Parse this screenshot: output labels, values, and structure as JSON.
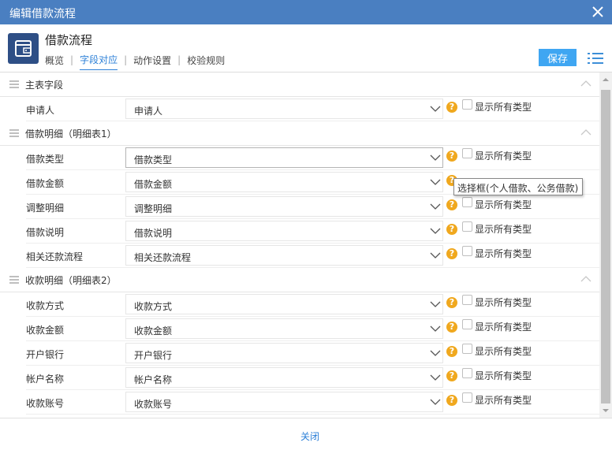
{
  "window": {
    "title": "编辑借款流程"
  },
  "header": {
    "title": "借款流程",
    "tabs": [
      {
        "label": "概览"
      },
      {
        "label": "字段对应",
        "active": true
      },
      {
        "label": "动作设置"
      },
      {
        "label": "校验规则"
      }
    ],
    "save_label": "保存"
  },
  "sections": [
    {
      "title": "主表字段",
      "rows": [
        {
          "label": "申请人",
          "value": "申请人",
          "checkbox_label": "显示所有类型"
        }
      ]
    },
    {
      "title": "借款明细（明细表1）",
      "rows": [
        {
          "label": "借款类型",
          "value": "借款类型",
          "checkbox_label": "显示所有类型"
        },
        {
          "label": "借款金额",
          "value": "借款金额",
          "checkbox_label": "显示所有类型"
        },
        {
          "label": "调整明细",
          "value": "调整明细",
          "checkbox_label": "显示所有类型"
        },
        {
          "label": "借款说明",
          "value": "借款说明",
          "checkbox_label": "显示所有类型"
        },
        {
          "label": "相关还款流程",
          "value": "相关还款流程",
          "checkbox_label": "显示所有类型"
        }
      ]
    },
    {
      "title": "收款明细（明细表2）",
      "rows": [
        {
          "label": "收款方式",
          "value": "收款方式",
          "checkbox_label": "显示所有类型"
        },
        {
          "label": "收款金额",
          "value": "收款金额",
          "checkbox_label": "显示所有类型"
        },
        {
          "label": "开户银行",
          "value": "开户银行",
          "checkbox_label": "显示所有类型"
        },
        {
          "label": "帐户名称",
          "value": "帐户名称",
          "checkbox_label": "显示所有类型"
        },
        {
          "label": "收款账号",
          "value": "收款账号",
          "checkbox_label": "显示所有类型"
        }
      ]
    }
  ],
  "help_glyph": "?",
  "tooltip": {
    "text": "选择框(个人借款、公务借款)"
  },
  "footer": {
    "close_label": "关闭"
  },
  "colors": {
    "titlebar": "#4a7fc1",
    "accent": "#2b7fd7",
    "save_button": "#3fa6f2",
    "help_icon": "#f0a81e",
    "app_icon": "#2e4f86"
  },
  "icons": {
    "close": "close-icon",
    "app": "wallet-icon",
    "menu": "list-menu-icon",
    "drag": "drag-handle-icon",
    "collapse": "chevron-up-icon",
    "dropdown": "chevron-down-icon",
    "help": "help-icon"
  }
}
